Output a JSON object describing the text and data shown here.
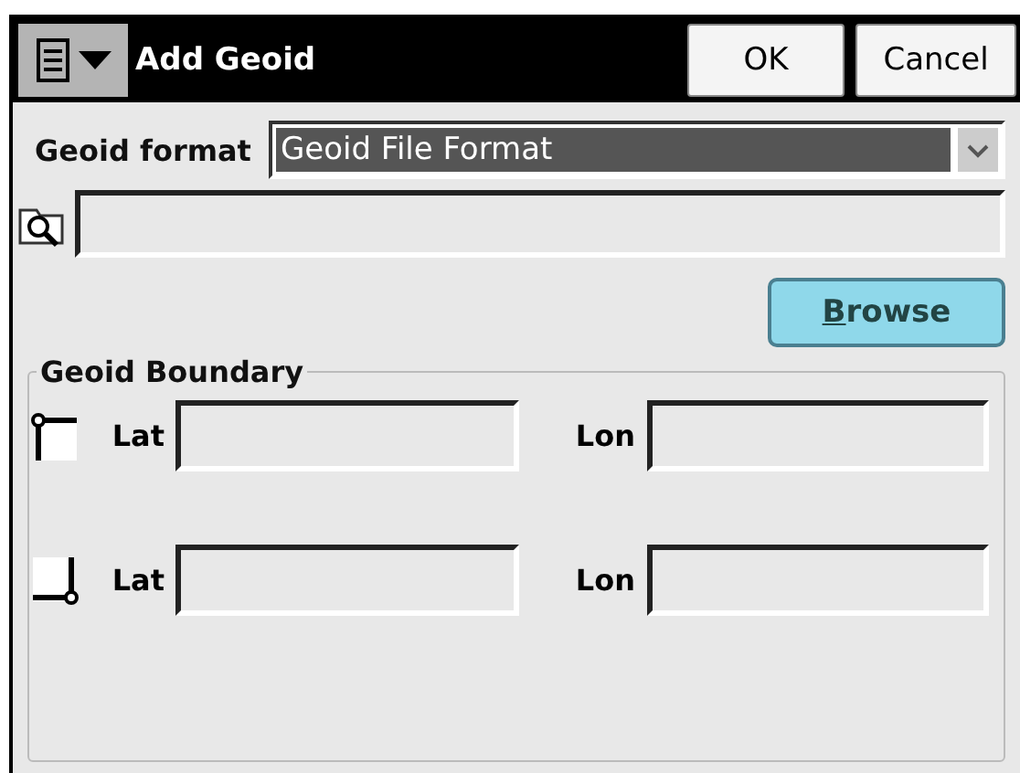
{
  "window": {
    "title": "Add Geoid",
    "buttons": [
      "OK",
      "Cancel"
    ]
  },
  "geoid_format": {
    "label": "Geoid format",
    "value": "Geoid File Format"
  },
  "browse_button": "Browse",
  "geoid_boundary": {
    "title": "Geoid Boundary",
    "corners": [
      {
        "kind": "top_left",
        "lat_label": "Lat",
        "lon_label": "Lon"
      },
      {
        "kind": "bottom_right",
        "lat_label": "Lat",
        "lon_label": "Lon"
      }
    ]
  }
}
